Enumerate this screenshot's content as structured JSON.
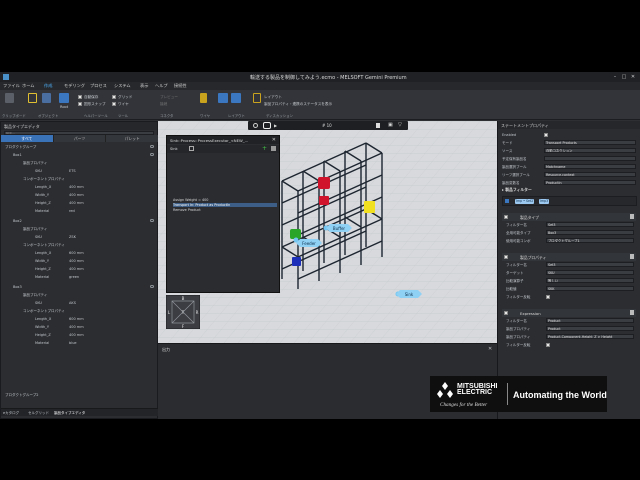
{
  "app": {
    "title": "輸送する製品を制御してみよう.ecmo - MELSOFT Gemini Premium",
    "menus": [
      "ファイル",
      "ホーム",
      "作成",
      "モデリング",
      "プロセス",
      "システム",
      "表示",
      "ヘルプ",
      "接続性"
    ],
    "active_menu": "作成"
  },
  "ribbon": {
    "groups": [
      "クリップボード",
      "オブジェクト",
      "ヘルパーツール",
      "ツール",
      "コネクタ",
      "ワイヤ",
      "レイアウト",
      "ディスカッション"
    ],
    "items": [
      {
        "label": "Root"
      },
      {
        "label": "自動保存"
      },
      {
        "label": "図形スナップ"
      },
      {
        "label": "グリッド"
      },
      {
        "label": "ワイヤ"
      },
      {
        "label": "プレビュー"
      },
      {
        "label": "接続"
      },
      {
        "label": "レイアウト"
      }
    ],
    "status_line": "製品プロパティ・連携のステータスを表示"
  },
  "left_panel": {
    "title": "製品タイプエディタ",
    "search_placeholder": "検索...",
    "tabs": [
      "すべて",
      "パーツ",
      "パレット"
    ],
    "active_tab": "すべて",
    "root": "プロダクトグループ",
    "items": [
      {
        "name": "Box1",
        "props": [
          {
            "k": "SKU",
            "v": "ETS"
          },
          {
            "k": "Length_X",
            "v": "400 mm"
          },
          {
            "k": "Width_Y",
            "v": "400 mm"
          },
          {
            "k": "Height_Z",
            "v": "400 mm"
          },
          {
            "k": "Material",
            "v": "red"
          }
        ]
      },
      {
        "name": "Box2",
        "props": [
          {
            "k": "SKU",
            "v": "ZSK"
          },
          {
            "k": "Length_X",
            "v": "600 mm"
          },
          {
            "k": "Width_Y",
            "v": "400 mm"
          },
          {
            "k": "Height_Z",
            "v": "400 mm"
          },
          {
            "k": "Material",
            "v": "green"
          }
        ]
      },
      {
        "name": "Box3",
        "props": [
          {
            "k": "SKU",
            "v": "AKS"
          },
          {
            "k": "Length_X",
            "v": "600 mm"
          },
          {
            "k": "Width_Y",
            "v": "400 mm"
          },
          {
            "k": "Height_Z",
            "v": "400 mm"
          },
          {
            "k": "Material",
            "v": "blue"
          }
        ]
      }
    ],
    "group_label": "製品プロパティ",
    "comp_label": "コンポーネントプロパティ",
    "footer_item": "プロダクトグループ2",
    "footer_tabs": [
      "eカタログ",
      "セルグリッド",
      "製品タイプエディタ"
    ]
  },
  "dialog": {
    "title": "Sink::Process::ProcessExecutor_<NEW_...",
    "header_label": "Sink",
    "rows": [
      "Assign Weight = 400",
      "Transport In: Product as ProductIn",
      "Remove Product"
    ]
  },
  "viewport": {
    "labels": [
      "Sink",
      "Buffer",
      "Feeder"
    ],
    "counter": "# 10",
    "nav": [
      "B",
      "L",
      "T",
      "R",
      "F"
    ]
  },
  "output": {
    "title": "出力"
  },
  "right_panel": {
    "title": "ステートメントプロパティ",
    "fields": [
      {
        "k": "Enabled",
        "v": ""
      },
      {
        "k": "モード",
        "v": "Transport Products"
      },
      {
        "k": "ソース",
        "v": "自動コネクション"
      },
      {
        "k": "予定保有製品名",
        "v": ""
      },
      {
        "k": "製品選択ブール",
        "v": "Matchname"
      },
      {
        "k": "リーフ選択ブール",
        "v": "Resource.context"
      },
      {
        "k": "製品変数名",
        "v": "ProductIn"
      }
    ],
    "filter_title": "製品フィルター",
    "chips": [
      "Imp • Set2",
      "Imp3"
    ],
    "sections": [
      {
        "title": "製品タイプ",
        "rows": [
          {
            "k": "フィルター名",
            "v": "Set3"
          },
          {
            "k": "全用可能タイプ",
            "v": "Box3"
          },
          {
            "k": "使用可能コンボ",
            "v": "プロダクトグループ1"
          }
        ]
      },
      {
        "title": "製品プロパティ",
        "rows": [
          {
            "k": "フィルター名",
            "v": "Set3"
          },
          {
            "k": "ターゲット",
            "v": "SKU"
          },
          {
            "k": "比較演算子",
            "v": "等しい"
          },
          {
            "k": "比較値",
            "v": "SKK"
          },
          {
            "k": "フィルター反転",
            "v": ""
          }
        ]
      },
      {
        "title": "Expression",
        "rows": [
          {
            "k": "フィルター名",
            "v": "Product"
          },
          {
            "k": "製品プロパティ",
            "v": "Product"
          },
          {
            "k": "製品プロパティ",
            "v": "Product.Component.Height_Z > Height"
          },
          {
            "k": "フィルター反転",
            "v": ""
          }
        ]
      }
    ]
  },
  "brand": {
    "name_1": "MITSUBISHI",
    "name_2": "ELECTRIC",
    "slogan": "Changes for the Better",
    "tagline": "Automating the World"
  },
  "colors": {
    "accent": "#3b73b9",
    "red": "#d0142c",
    "green": "#2aa52a",
    "blue": "#1b2fb8",
    "yellow": "#f0e020",
    "label": "#73c6f2"
  }
}
